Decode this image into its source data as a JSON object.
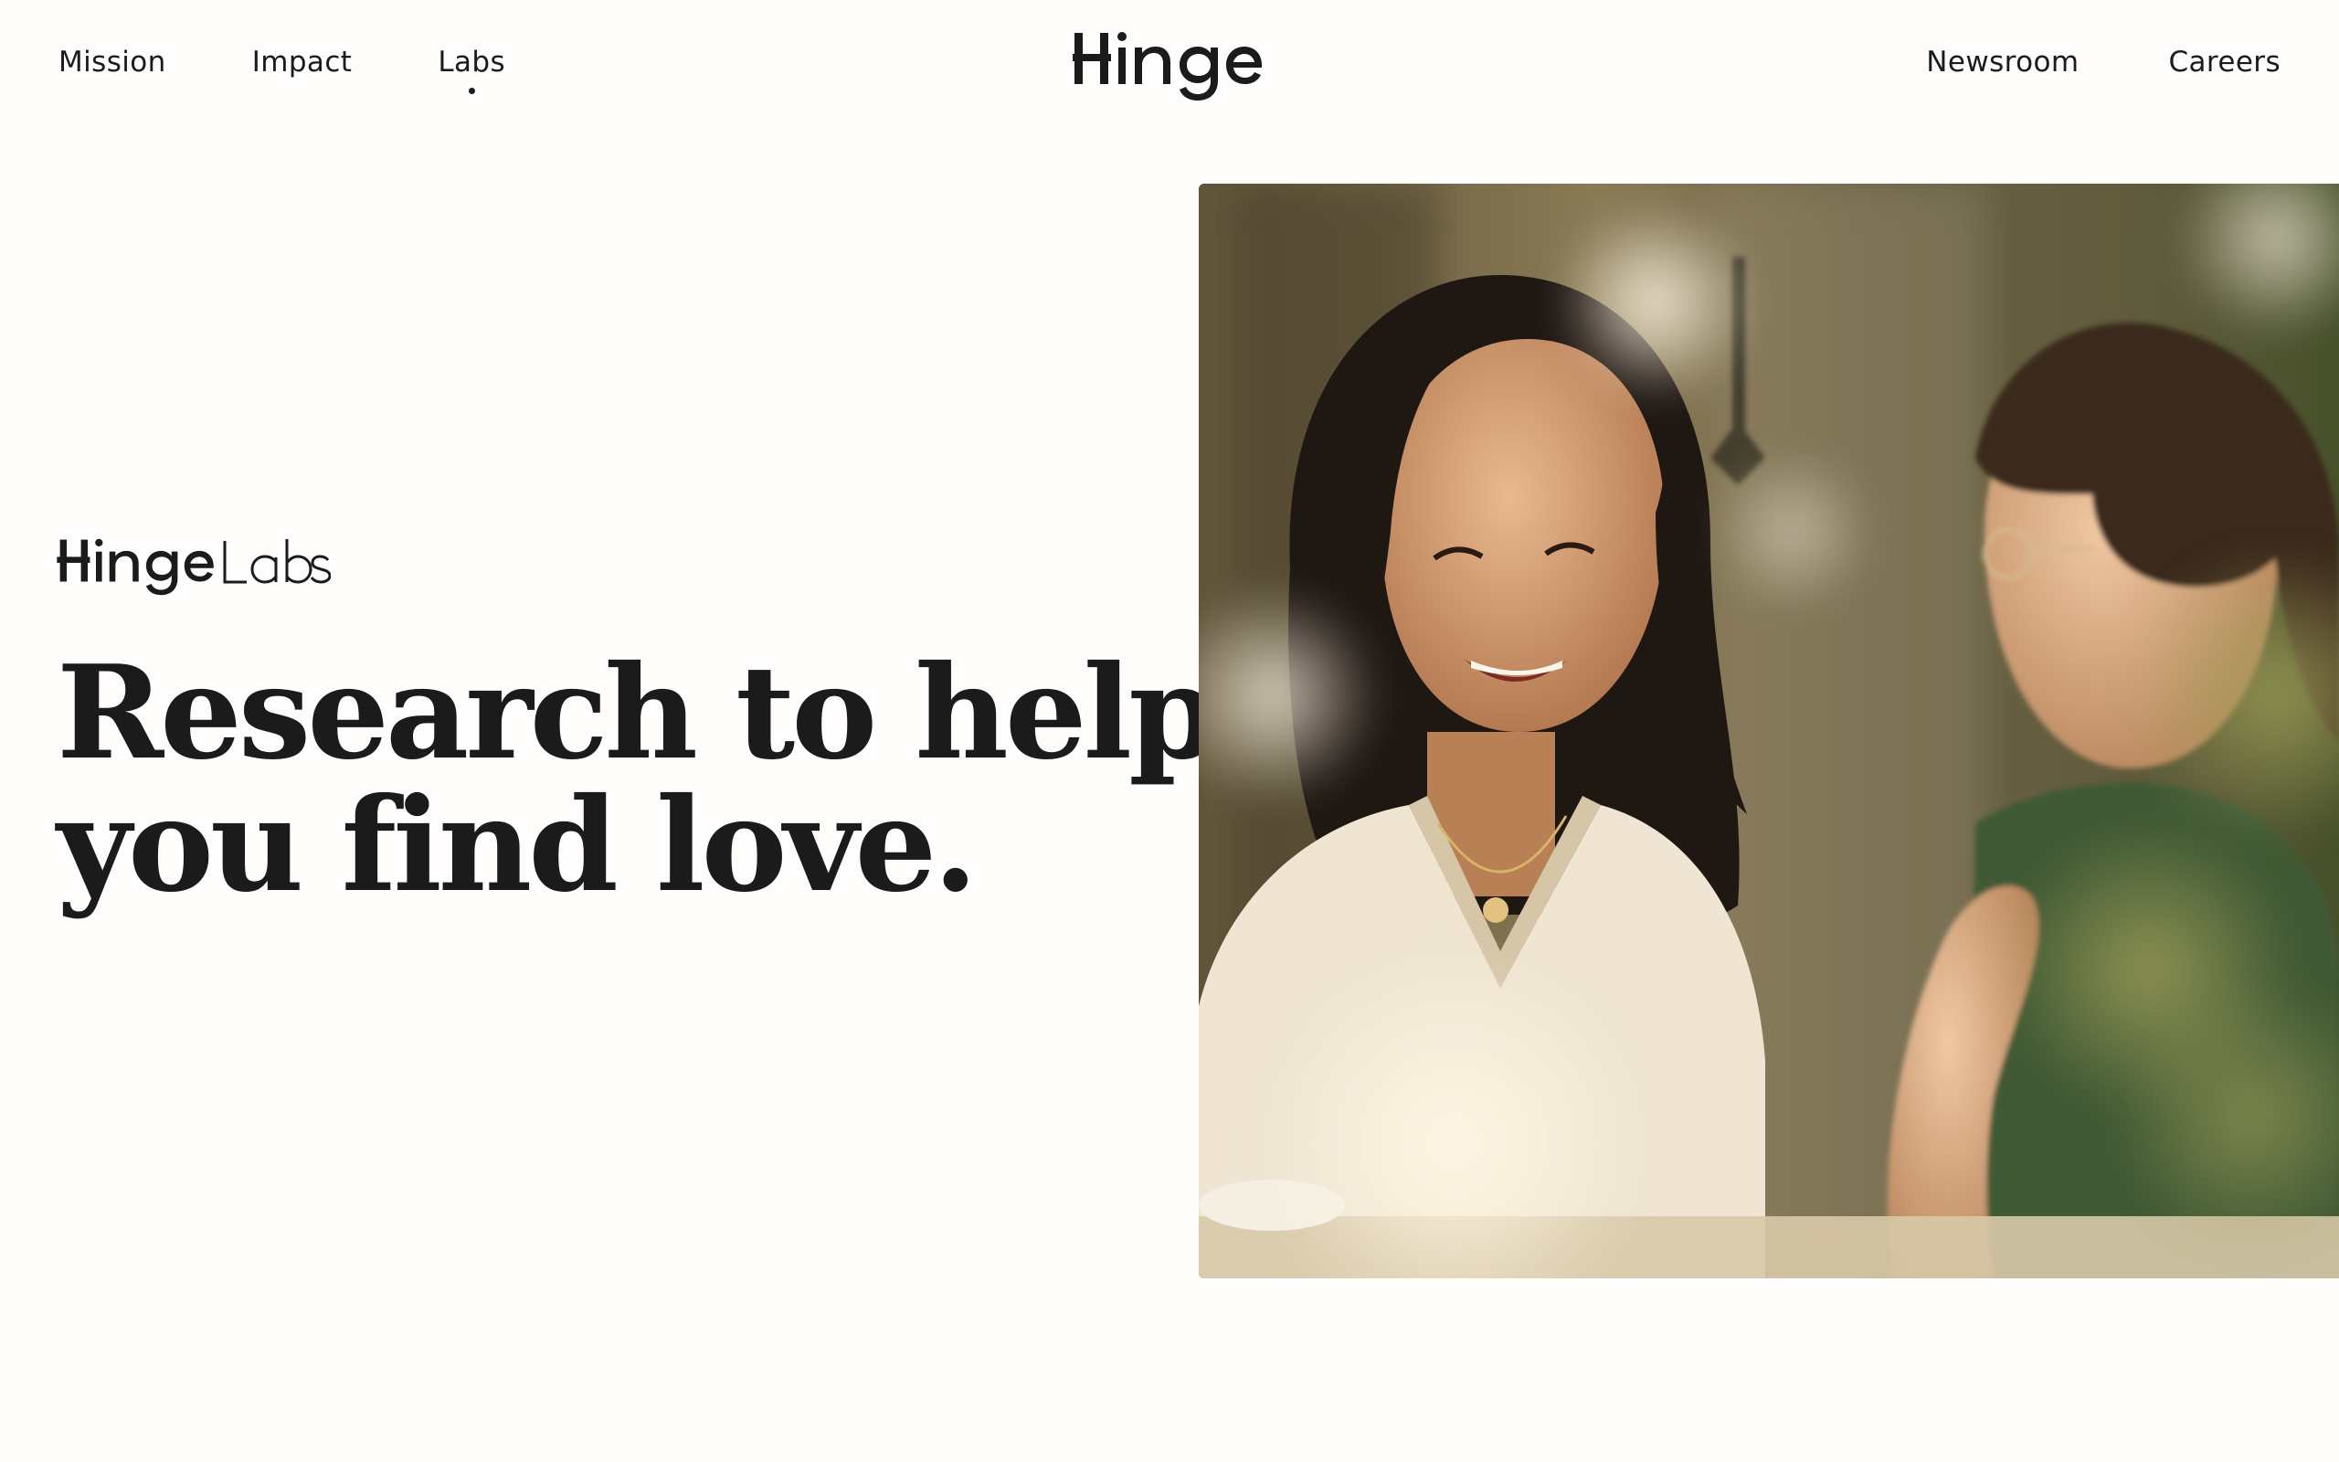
{
  "nav": {
    "left": [
      {
        "label": "Mission",
        "active": false
      },
      {
        "label": "Impact",
        "active": false
      },
      {
        "label": "Labs",
        "active": true
      }
    ],
    "right": [
      {
        "label": "Newsroom"
      },
      {
        "label": "Careers"
      }
    ],
    "brand_name": "Hinge"
  },
  "hero": {
    "logo": {
      "primary": "Hinge",
      "secondary": "Labs"
    },
    "headline_line1": "Research to help",
    "headline_line2": "you find love.",
    "image_alt": "Woman smiling at a man across a table"
  },
  "colors": {
    "text": "#1b1b1b",
    "background": "#fffdfc"
  }
}
